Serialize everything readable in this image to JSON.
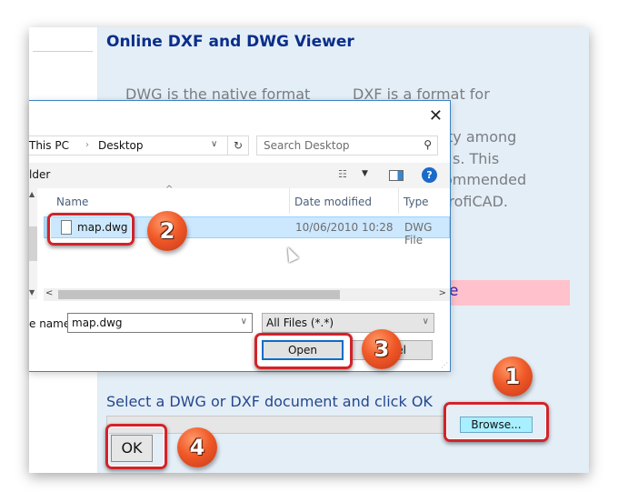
{
  "page": {
    "title": "Online DXF and DWG Viewer",
    "col1_lines": [
      "DWG is the native format"
    ],
    "col2_lines": [
      "DXF is a format for",
      "",
      "ty among",
      "s. This",
      "ommended",
      "ProfiCAD."
    ],
    "pink_bar_text": "e",
    "select_label": "Select a DWG or DXF document and click OK",
    "file_input_value": "",
    "browse_label": "Browse...",
    "ok_label": "OK"
  },
  "dialog": {
    "close_icon": "close-icon",
    "breadcrumb": [
      "This PC",
      "Desktop"
    ],
    "breadcrumb_separator": "›",
    "search_placeholder": "Search Desktop",
    "toolbar_new_folder": "lder",
    "columns": [
      "Name",
      "Date modified",
      "Type"
    ],
    "files": [
      {
        "name": "map.dwg",
        "date_modified": "10/06/2010 10:28",
        "type": "DWG File",
        "selected": true
      }
    ],
    "file_name_label": "e name:",
    "file_name_value": "map.dwg",
    "filter_value": "All Files (*.*)",
    "open_label": "Open",
    "cancel_label": "el"
  },
  "annotations": {
    "steps": [
      "1",
      "2",
      "3",
      "4"
    ],
    "highlight_color": "#d2232a",
    "badge_color": "#f05a28"
  },
  "colors": {
    "title": "#0b2e8c",
    "body_text": "#7a7d82",
    "page_bg": "#e4eef6",
    "selection": "#cce8ff",
    "browse_bg": "#a8f0ff",
    "pink_bar": "#ffc1cb"
  }
}
